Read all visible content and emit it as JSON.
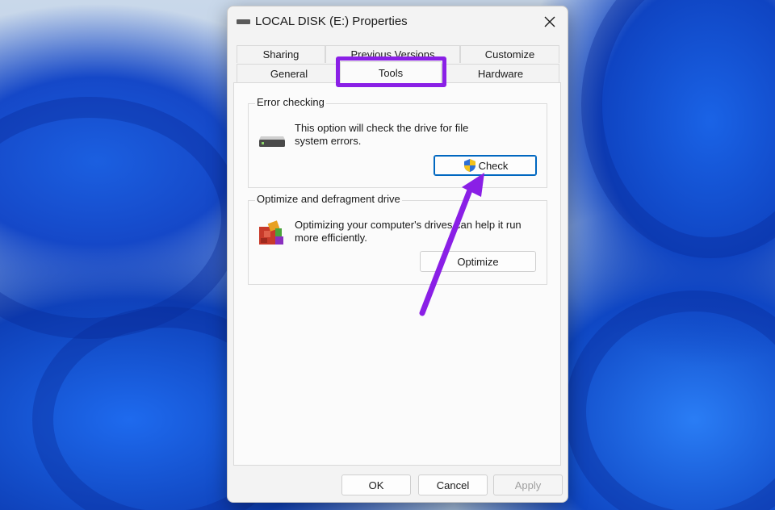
{
  "window": {
    "title": "LOCAL DISK (E:) Properties"
  },
  "tabs": {
    "row1": [
      {
        "label": "Sharing"
      },
      {
        "label": "Previous Versions"
      },
      {
        "label": "Customize"
      }
    ],
    "row2": [
      {
        "label": "General"
      },
      {
        "label": "Tools",
        "active": true
      },
      {
        "label": "Hardware"
      }
    ]
  },
  "error_checking": {
    "title": "Error checking",
    "description_line1": "This option will check the drive for file",
    "description_line2": "system errors.",
    "check_label": "Check",
    "icon": "drive-icon"
  },
  "optimize": {
    "title": "Optimize and defragment drive",
    "description_line1": "Optimizing your computer's drives can help it run",
    "description_line2": "more efficiently.",
    "optimize_label": "Optimize",
    "icon": "defrag-icon"
  },
  "footer": {
    "ok_label": "OK",
    "cancel_label": "Cancel",
    "apply_label": "Apply"
  },
  "colors": {
    "highlight": "#8a1fe6",
    "accent": "#0067c0"
  }
}
